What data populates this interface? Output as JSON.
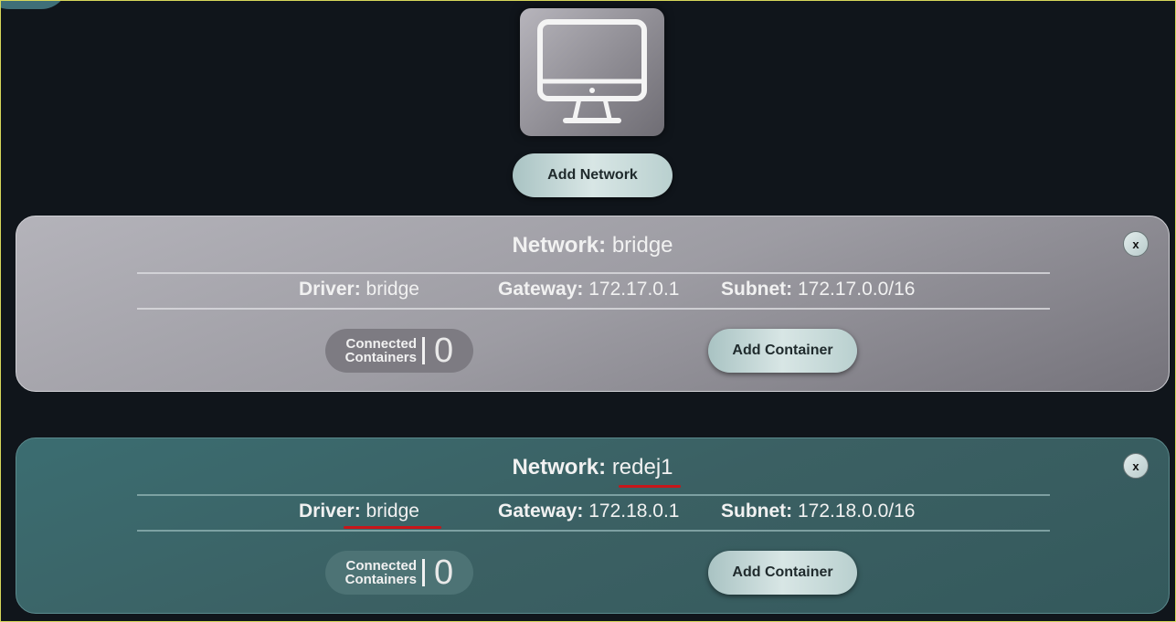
{
  "toolbar": {
    "icon": "monitor-icon",
    "add_network_label": "Add Network"
  },
  "networks": [
    {
      "title_label": "Network:",
      "name": "bridge",
      "driver_label": "Driver:",
      "driver": "bridge",
      "gateway_label": "Gateway:",
      "gateway": "172.17.0.1",
      "subnet_label": "Subnet:",
      "subnet": "172.17.0.0/16",
      "connected_label_1": "Connected",
      "connected_label_2": "Containers",
      "connected_count": "0",
      "add_container_label": "Add Container",
      "close_label": "x",
      "color": "#a5a4ab"
    },
    {
      "title_label": "Network:",
      "name": "redej1",
      "driver_label": "Driver:",
      "driver": "bridge",
      "gateway_label": "Gateway:",
      "gateway": "172.18.0.1",
      "subnet_label": "Subnet:",
      "subnet": "172.18.0.0/16",
      "connected_label_1": "Connected",
      "connected_label_2": "Containers",
      "connected_count": "0",
      "add_container_label": "Add Container",
      "close_label": "x",
      "color": "#3b6467"
    }
  ],
  "colors": {
    "background": "#10151b",
    "button_bg": "#cfe0df",
    "annotation_red": "#c8161a"
  }
}
